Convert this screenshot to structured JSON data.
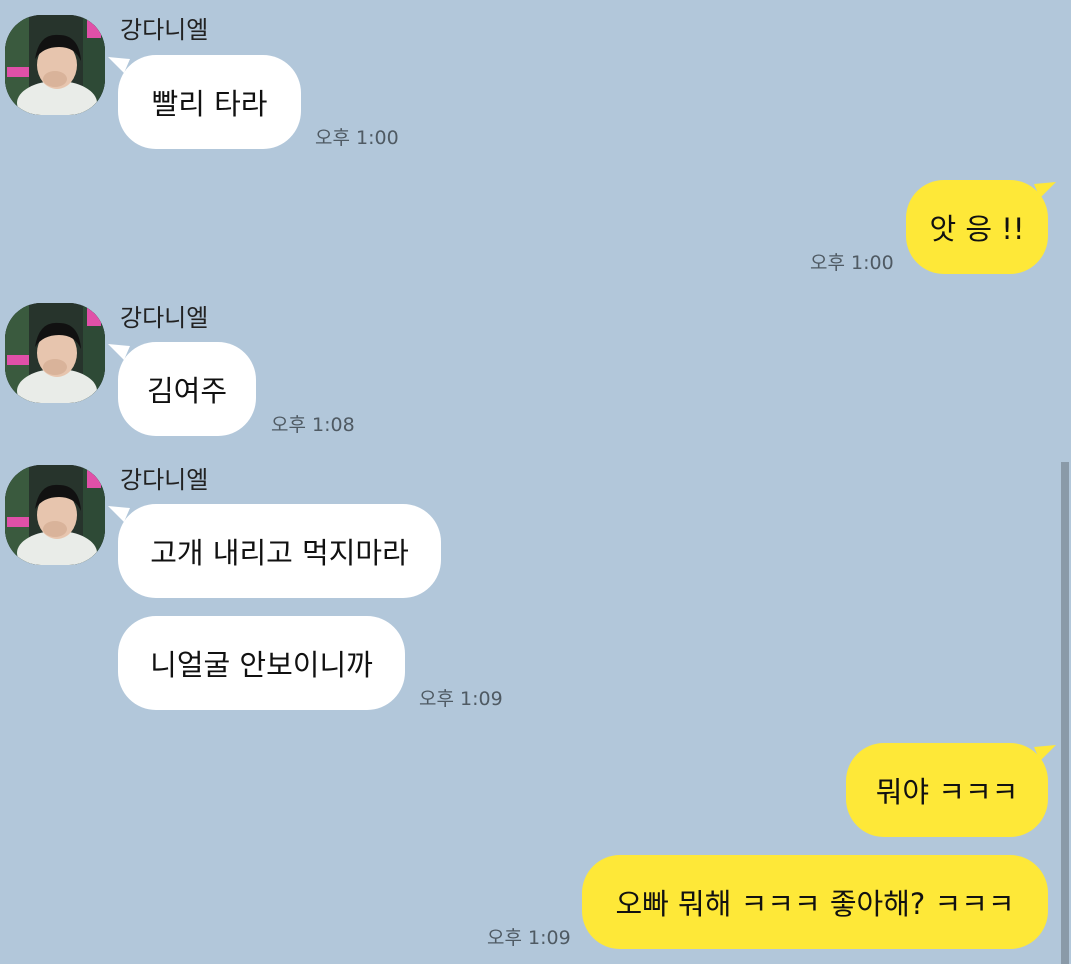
{
  "chat": {
    "messages": [
      {
        "sender": "강다니엘",
        "direction": "incoming",
        "texts": [
          "빨리 타라"
        ],
        "time": "오후 1:00"
      },
      {
        "direction": "outgoing",
        "texts": [
          "앗 응 !!"
        ],
        "time": "오후 1:00"
      },
      {
        "sender": "강다니엘",
        "direction": "incoming",
        "texts": [
          "김여주"
        ],
        "time": "오후 1:08"
      },
      {
        "sender": "강다니엘",
        "direction": "incoming",
        "texts": [
          "고개 내리고 먹지마라",
          "니얼굴 안보이니까"
        ],
        "time": "오후 1:09"
      },
      {
        "direction": "outgoing",
        "texts": [
          "뭐야 ㅋㅋㅋ",
          "오빠 뭐해 ㅋㅋㅋ 좋아해? ㅋㅋㅋ"
        ],
        "time": "오후 1:09"
      }
    ]
  },
  "colors": {
    "background": "#b2c7da",
    "incoming_bubble": "#ffffff",
    "outgoing_bubble": "#fee838"
  },
  "icons": {
    "avatar": "profile-photo"
  }
}
